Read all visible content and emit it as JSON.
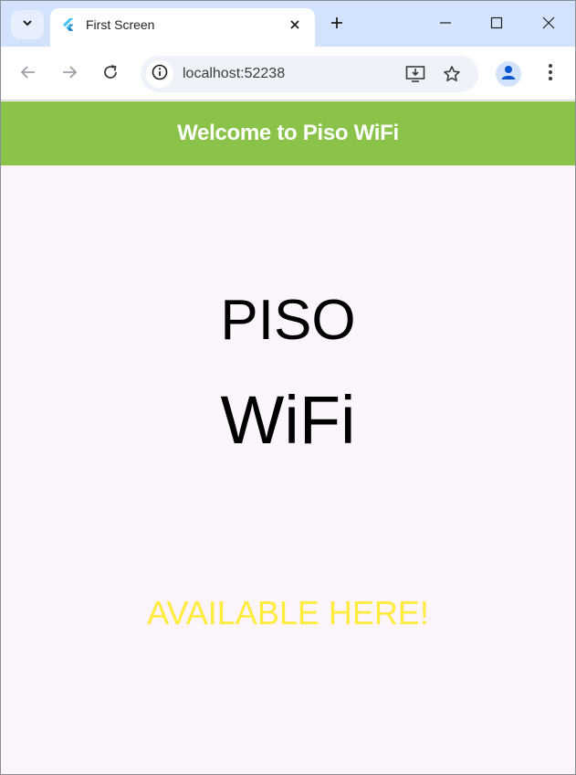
{
  "browser": {
    "tab_title": "First Screen",
    "url": "localhost:52238",
    "colors": {
      "tabstrip": "#d3e3fd",
      "toolbar": "#ffffff",
      "omnibox": "#eef2f9"
    },
    "icons": [
      "tab-search-icon",
      "flutter-icon",
      "close-icon",
      "plus-icon",
      "minimize-icon",
      "maximize-icon",
      "close-window-icon",
      "back-icon",
      "forward-icon",
      "reload-icon",
      "info-icon",
      "install-app-icon",
      "star-icon",
      "profile-icon",
      "more-icon"
    ]
  },
  "app": {
    "appbar_title": "Welcome to Piso WiFi",
    "hero_line1": "PISO",
    "hero_line2": "WiFi",
    "tagline": "AVAILABLE HERE!",
    "colors": {
      "appbar": "#8bc34a",
      "background": "#fdf5fd",
      "tagline": "#ffeb3b"
    }
  }
}
